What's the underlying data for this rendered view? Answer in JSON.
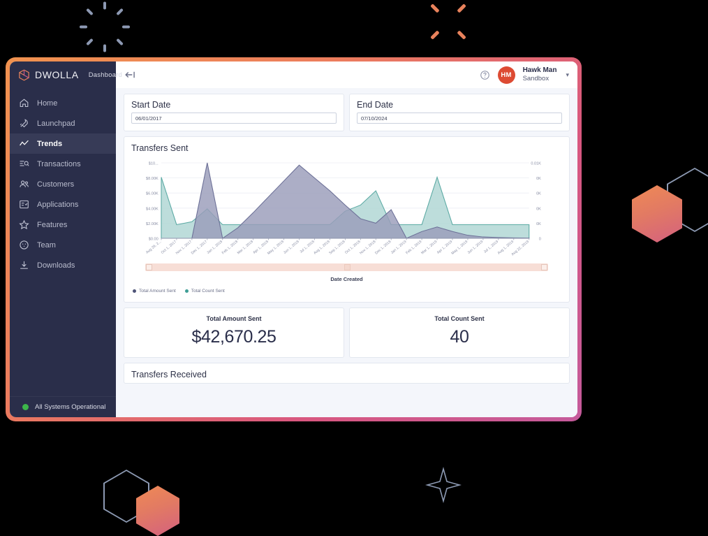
{
  "brand": {
    "name": "DWOLLA",
    "sub": "Dashboard",
    "logo_icon": "dwolla-cube-logo"
  },
  "sidebar": {
    "items": [
      {
        "label": "Home",
        "icon": "home-icon",
        "active": false
      },
      {
        "label": "Launchpad",
        "icon": "rocket-icon",
        "active": false
      },
      {
        "label": "Trends",
        "icon": "trend-line-icon",
        "active": true
      },
      {
        "label": "Transactions",
        "icon": "list-search-icon",
        "active": false
      },
      {
        "label": "Customers",
        "icon": "people-icon",
        "active": false
      },
      {
        "label": "Applications",
        "icon": "form-check-icon",
        "active": false
      },
      {
        "label": "Features",
        "icon": "star-icon",
        "active": false
      },
      {
        "label": "Team",
        "icon": "team-circle-icon",
        "active": false
      },
      {
        "label": "Downloads",
        "icon": "download-icon",
        "active": false
      }
    ],
    "status": {
      "label": "All Systems Operational",
      "color": "#3cb54a"
    }
  },
  "topbar": {
    "back_icon": "back-arrow-icon",
    "help_icon": "help-circle-icon",
    "avatar_initials": "HM",
    "avatar_color": "#dd4b33",
    "account_name": "Hawk Man",
    "account_env": "Sandbox",
    "caret_icon": "chevron-down-icon"
  },
  "filters": {
    "start": {
      "label": "Start Date",
      "value": "06/01/2017",
      "placeholder": "mm/dd/yyyy"
    },
    "end": {
      "label": "End Date",
      "value": "07/10/2024",
      "placeholder": "mm/dd/yyyy"
    }
  },
  "sections": {
    "transfers_sent": "Transfers Sent",
    "transfers_received": "Transfers Received"
  },
  "stats": [
    {
      "label": "Total Amount Sent",
      "value": "$42,670.25"
    },
    {
      "label": "Total Count Sent",
      "value": "40"
    }
  ],
  "chart_data": {
    "type": "area",
    "title": "Transfers Sent",
    "xlabel": "Date Created",
    "ylabel": "",
    "grid": true,
    "legend_position": "bottom-left",
    "y_left_ticks": [
      "$0.00",
      "$2.00K",
      "$4.00K",
      "$6.00K",
      "$8.00K",
      "$10..."
    ],
    "y_right_ticks": [
      "0",
      "0K",
      "0K",
      "0K",
      "0K",
      "0.01K"
    ],
    "ylim_left": [
      0,
      10000
    ],
    "ylim_right": [
      0,
      10
    ],
    "categories": [
      "Aug 29, 2...",
      "Oct 1, 2017",
      "Nov 1, 2017",
      "Dec 1, 2017",
      "Jan 1, 2018",
      "Feb 1, 2018",
      "Mar 1, 2018",
      "Apr 1, 2018",
      "May 1, 2018",
      "Jun 1, 2018",
      "Jul 1, 2018",
      "Aug 1, 2018",
      "Sep 1, 2018",
      "Oct 1, 2018",
      "Nov 1, 2018",
      "Dec 1, 2018",
      "Jan 1, 2019",
      "Feb 1, 2019",
      "Mar 1, 2019",
      "Apr 1, 2019",
      "May 1, 2019",
      "Jun 1, 2019",
      "Jul 1, 2019",
      "Aug 1, 2019",
      "Aug 22, 2019"
    ],
    "series": [
      {
        "name": "Total Amount Sent",
        "color": "#6b6f96",
        "fill": "#9a9cba",
        "axis": "left",
        "values": [
          0,
          0,
          0,
          10000,
          0,
          1400,
          3400,
          5500,
          7600,
          9700,
          8000,
          6300,
          4400,
          2600,
          2000,
          3800,
          0,
          900,
          1500,
          900,
          400,
          180,
          100,
          60,
          40
        ]
      },
      {
        "name": "Total Count Sent",
        "color": "#5aa9a3",
        "fill": "#aed5d3",
        "axis": "right",
        "values": [
          8.1,
          1.8,
          2.2,
          3.9,
          1.8,
          1.8,
          1.8,
          1.8,
          1.8,
          1.8,
          1.8,
          1.8,
          3.6,
          4.4,
          6.3,
          1.8,
          1.8,
          1.8,
          8.1,
          1.8,
          1.8,
          1.8,
          1.8,
          1.8,
          1.8
        ]
      }
    ],
    "range_slider": {
      "left_pct": 0,
      "right_pct": 100
    }
  },
  "decorations": {
    "burst_gray": "loading-burst-icon",
    "sparkle_orange": "sparkle-x-icon",
    "diamond": "four-point-star-icon",
    "hex_gradient": "#ef8a55",
    "hex_outline": "#8d9ab3"
  }
}
